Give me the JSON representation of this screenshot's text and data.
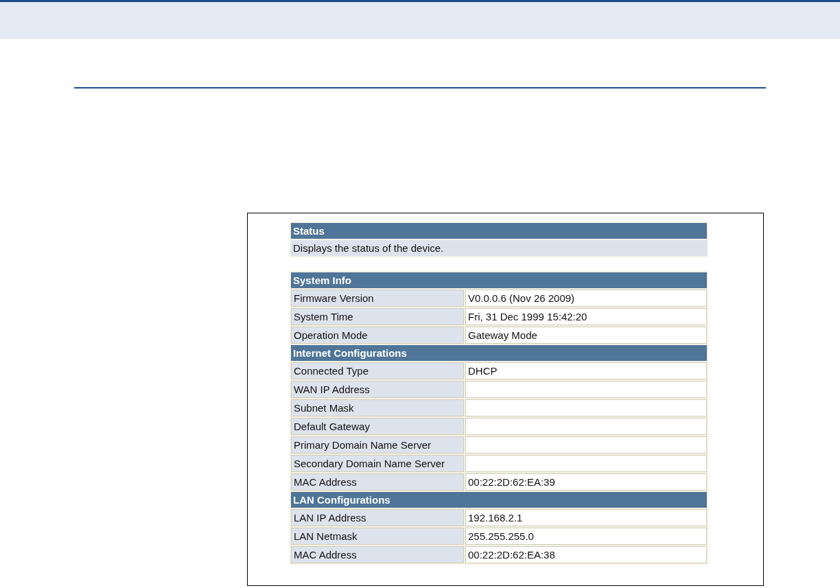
{
  "status": {
    "title": "Status",
    "description": "Displays the status of the device."
  },
  "sections": [
    {
      "title": "System Info",
      "rows": [
        {
          "label": "Firmware Version",
          "value": "V0.0.0.6 (Nov 26 2009)"
        },
        {
          "label": "System Time",
          "value": "Fri, 31 Dec 1999 15:42:20"
        },
        {
          "label": "Operation Mode",
          "value": "Gateway Mode"
        }
      ]
    },
    {
      "title": "Internet Configurations",
      "rows": [
        {
          "label": "Connected Type",
          "value": "DHCP"
        },
        {
          "label": "WAN IP Address"
        },
        {
          "label": "Subnet Mask"
        },
        {
          "label": "Default Gateway"
        },
        {
          "label": "Primary Domain Name Server"
        },
        {
          "label": "Secondary Domain Name Server"
        },
        {
          "label": "MAC Address",
          "value": "00:22:2D:62:EA:39"
        }
      ]
    },
    {
      "title": "LAN Configurations",
      "rows": [
        {
          "label": "LAN IP Address",
          "value": "192.168.2.1"
        },
        {
          "label": "LAN Netmask",
          "value": "255.255.255.0"
        },
        {
          "label": "MAC Address",
          "value": "00:22:2D:62:EA:38"
        }
      ]
    }
  ]
}
